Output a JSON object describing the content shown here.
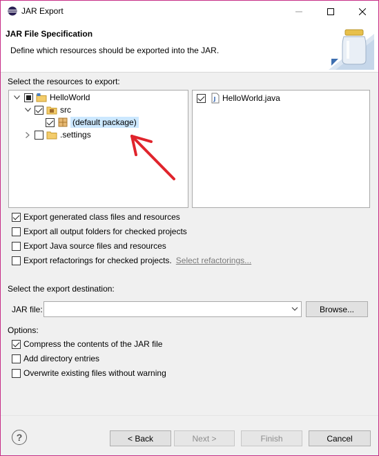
{
  "window": {
    "title": "JAR Export"
  },
  "banner": {
    "title": "JAR File Specification",
    "description": "Define which resources should be exported into the JAR."
  },
  "resources": {
    "label": "Select the resources to export:",
    "tree": [
      {
        "label": "HelloWorld",
        "state": "partial",
        "expanded": true,
        "icon": "project-folder-icon"
      },
      {
        "label": "src",
        "state": "checked",
        "expanded": true,
        "icon": "source-folder-icon"
      },
      {
        "label": "(default package)",
        "state": "checked",
        "selected": true,
        "icon": "package-icon"
      },
      {
        "label": ".settings",
        "state": "unchecked",
        "expanded": false,
        "icon": "folder-icon"
      }
    ],
    "files": [
      {
        "label": "HelloWorld.java",
        "state": "checked",
        "icon": "java-file-icon"
      }
    ]
  },
  "export_options": {
    "generated_class": "Export generated class files and resources",
    "output_folders": "Export all output folders for checked projects",
    "java_source": "Export Java source files and resources",
    "refactorings": "Export refactorings for checked projects.",
    "select_refactorings": "Select refactorings..."
  },
  "destination": {
    "label": "Select the export destination:",
    "jar_label": "JAR file:",
    "jar_value": "",
    "browse": "Browse..."
  },
  "options": {
    "label": "Options:",
    "compress": "Compress the contents of the JAR file",
    "directory_entries": "Add directory entries",
    "overwrite": "Overwrite existing files without warning"
  },
  "buttons": {
    "back": "< Back",
    "next": "Next >",
    "finish": "Finish",
    "cancel": "Cancel"
  },
  "annotation": {
    "color": "#e0242c"
  }
}
